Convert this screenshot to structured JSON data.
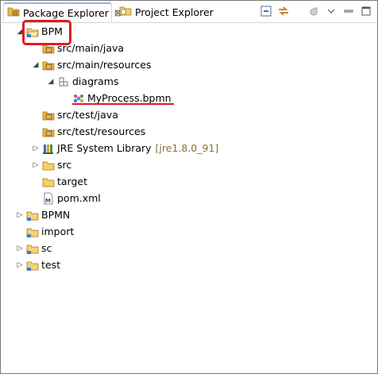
{
  "tabs": [
    {
      "label": "Package Explorer",
      "close": "⊠",
      "active": true
    },
    {
      "label": "Project Explorer",
      "active": false
    }
  ],
  "toolbar": {
    "collapse_icon": "collapse-all-icon",
    "link_icon": "link-with-editor-icon",
    "focus_icon": "focus-icon",
    "menu_icon": "view-menu-icon",
    "minimize_icon": "minimize-icon",
    "maximize_icon": "maximize-icon"
  },
  "tree": [
    {
      "label": "BPM",
      "expanded": true,
      "icon": "project-folder-icon"
    },
    {
      "label": "src/main/java",
      "icon": "source-folder-icon"
    },
    {
      "label": "src/main/resources",
      "expanded": true,
      "icon": "source-folder-icon"
    },
    {
      "label": "diagrams",
      "expanded": true,
      "icon": "package-icon"
    },
    {
      "label": "MyProcess.bpmn",
      "icon": "bpmn-file-icon"
    },
    {
      "label": "src/test/java",
      "icon": "source-folder-icon"
    },
    {
      "label": "src/test/resources",
      "icon": "source-folder-icon"
    },
    {
      "label": "JRE System Library",
      "decoration": "[jre1.8.0_91]",
      "expanded": false,
      "icon": "library-icon"
    },
    {
      "label": "src",
      "expanded": false,
      "icon": "folder-icon"
    },
    {
      "label": "target",
      "icon": "folder-icon"
    },
    {
      "label": "pom.xml",
      "icon": "xml-file-icon"
    },
    {
      "label": "BPMN",
      "expanded": false,
      "icon": "project-folder-icon"
    },
    {
      "label": "import",
      "icon": "project-folder-icon"
    },
    {
      "label": "sc",
      "expanded": false,
      "icon": "project-folder-icon"
    },
    {
      "label": "test",
      "expanded": false,
      "icon": "project-folder-icon"
    }
  ],
  "colors": {
    "highlight": "#e01b24",
    "decoration": "#8b6f3a"
  }
}
